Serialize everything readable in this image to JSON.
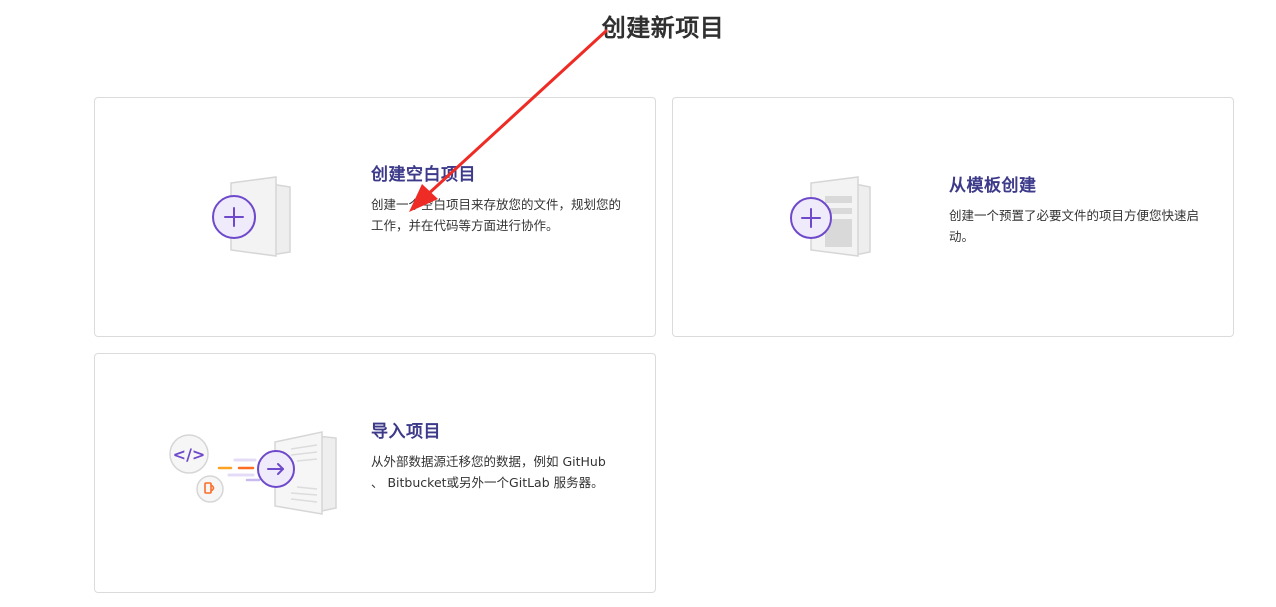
{
  "page": {
    "title": "创建新项目"
  },
  "cards": {
    "blank": {
      "title": "创建空白项目",
      "description": "创建一个空白项目来存放您的文件，规划您的工作，并在代码等方面进行协作。",
      "icon": "plus-document-icon"
    },
    "template": {
      "title": "从模板创建",
      "description": "创建一个预置了必要文件的项目方便您快速启动。",
      "icon": "template-document-icon"
    },
    "import": {
      "title": "导入项目",
      "description": "从外部数据源迁移您的数据，例如 GitHub 、 Bitbucket或另外一个GitLab 服务器。",
      "icon": "import-document-icon"
    }
  },
  "colors": {
    "title_text": "#3d3a8a",
    "icon_purple": "#6e49cb",
    "icon_purple_bg": "#f0ebfb",
    "annotation_red": "#ee2b24",
    "card_border": "#dbdbdb"
  }
}
